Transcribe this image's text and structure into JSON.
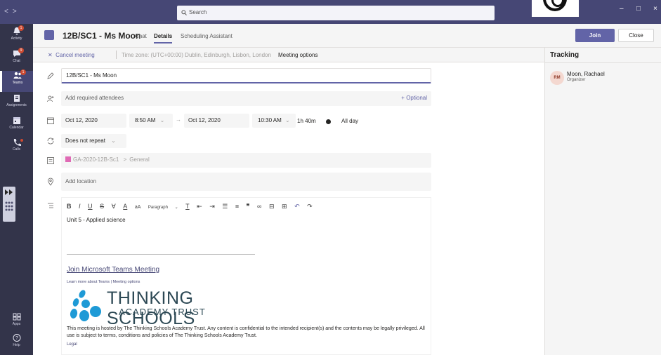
{
  "window": {
    "search_placeholder": "Search",
    "minimize": "–",
    "restore": "□",
    "close": "×"
  },
  "rail": {
    "items": [
      {
        "label": "Activity",
        "badge": "1"
      },
      {
        "label": "Chat",
        "badge": "9"
      },
      {
        "label": "Teams",
        "badge": "1"
      },
      {
        "label": "Assignments",
        "badge": ""
      },
      {
        "label": "Calendar",
        "badge": ""
      },
      {
        "label": "Calls",
        "badge": ""
      },
      {
        "label": "Apps",
        "badge": ""
      },
      {
        "label": "Help",
        "badge": ""
      }
    ]
  },
  "header": {
    "title": "12B/SC1 - Ms Moon",
    "tabs": [
      "Chat",
      "Details",
      "Scheduling Assistant"
    ],
    "join_label": "Join",
    "close_label": "Close"
  },
  "subbar": {
    "cancel_label": "Cancel meeting",
    "timezone": "Time zone: (UTC+00:00) Dublin, Edinburgh, Lisbon, London",
    "options_label": "Meeting options"
  },
  "form": {
    "title_value": "12B/SC1 - Ms Moon",
    "attendees_placeholder": "Add required attendees",
    "optional_label": "+ Optional",
    "start_date": "Oct 12, 2020",
    "start_time": "8:50 AM",
    "end_date": "Oct 12, 2020",
    "end_time": "10:30 AM",
    "duration": "1h 40m",
    "allday_label": "All day",
    "repeat_value": "Does not repeat",
    "channel_team": "GA-2020-12B-Sc1",
    "channel_sep": ">",
    "channel_name": "General",
    "location_placeholder": "Add location"
  },
  "editor": {
    "paragraph_label": "Paragraph",
    "body_text": "Unit 5 - Applied science",
    "join_link": "Join Microsoft Teams Meeting",
    "learn_more": "Learn more about Teams",
    "meeting_options": "Meeting options",
    "logo_line1": "THINKING SCHOOLS",
    "logo_line2": "ACADEMY TRUST",
    "disclaimer": "This meeting is hosted by The Thinking Schools Academy Trust. Any content is confidential to the intended recipient(s) and the contents may be legally privileged. All use is subject to terms, conditions and policies of The Thinking Schools Academy Trust.",
    "legal": "Legal"
  },
  "tracking": {
    "heading": "Tracking",
    "attendees": [
      {
        "initials": "RM",
        "name": "Moon, Rachael",
        "role": "Organizer"
      }
    ]
  },
  "colors": {
    "brand": "#6264a7",
    "rail": "#33344a",
    "topbar": "#464775",
    "badge": "#cc4a31"
  }
}
